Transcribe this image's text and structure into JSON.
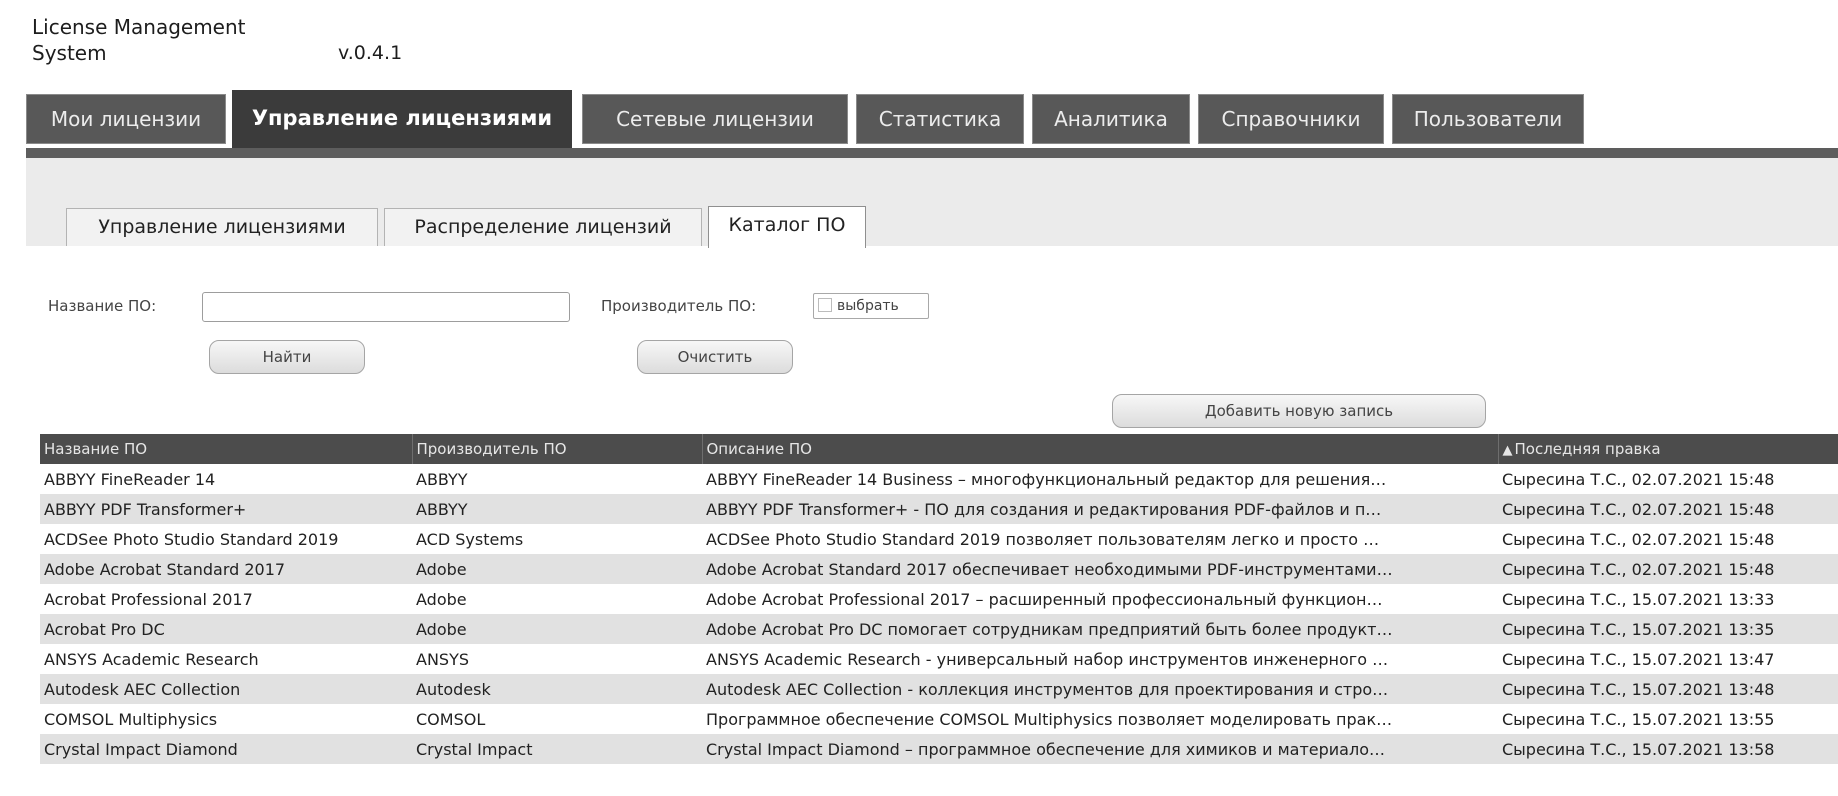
{
  "app": {
    "title": "License Management System",
    "version": "v.0.4.1"
  },
  "main_tabs": [
    {
      "label": "Мои лицензии",
      "active": false
    },
    {
      "label": "Управление лицензиями",
      "active": true
    },
    {
      "label": "Сетевые лицензии",
      "active": false
    },
    {
      "label": "Статистика",
      "active": false
    },
    {
      "label": "Аналитика",
      "active": false
    },
    {
      "label": "Справочники",
      "active": false
    },
    {
      "label": "Пользователи",
      "active": false
    }
  ],
  "sub_tabs": [
    {
      "label": "Управление лицензиями",
      "active": false
    },
    {
      "label": "Распределение лицензий",
      "active": false
    },
    {
      "label": "Каталог ПО",
      "active": true
    }
  ],
  "filter": {
    "name_label": "Название ПО:",
    "name_value": "",
    "vendor_label": "Производитель ПО:",
    "vendor_pick_label": "выбрать",
    "search_button": "Найти",
    "clear_button": "Очистить",
    "add_button": "Добавить новую запись"
  },
  "table": {
    "columns": [
      "Название ПО",
      "Производитель ПО",
      "Описание ПО",
      "Последняя правка"
    ],
    "sort_icon": "sort-ascending-icon",
    "rows": [
      {
        "name": "ABBYY FineReader 14",
        "vendor": "ABBYY",
        "description": "ABBYY FineReader 14 Business – многофункциональный редактор для решения…",
        "last_edit": "Сыресина Т.С., 02.07.2021 15:48"
      },
      {
        "name": "ABBYY PDF Transformer+",
        "vendor": "ABBYY",
        "description": "ABBYY PDF Transformer+ - ПО для создания и редактирования PDF-файлов и п…",
        "last_edit": "Сыресина Т.С., 02.07.2021 15:48"
      },
      {
        "name": "ACDSee Photo Studio Standard 2019",
        "vendor": "ACD Systems",
        "description": "ACDSee Photo Studio Standard 2019 позволяет пользователям легко и просто …",
        "last_edit": "Сыресина Т.С., 02.07.2021 15:48"
      },
      {
        "name": "Adobe Acrobat Standard 2017",
        "vendor": "Adobe",
        "description": "Adobe Acrobat Standard 2017 обеспечивает необходимыми PDF-инструментами…",
        "last_edit": "Сыресина Т.С., 02.07.2021 15:48"
      },
      {
        "name": "Acrobat Professional 2017",
        "vendor": "Adobe",
        "description": "Adobe Acrobat Professional 2017 – расширенный профессиональный функцион…",
        "last_edit": "Сыресина Т.С., 15.07.2021 13:33"
      },
      {
        "name": "Acrobat Pro DC",
        "vendor": "Adobe",
        "description": "Adobe Acrobat Pro DC помогает сотрудникам предприятий быть более продукт…",
        "last_edit": "Сыресина Т.С., 15.07.2021 13:35"
      },
      {
        "name": "ANSYS Academic Research",
        "vendor": "ANSYS",
        "description": "ANSYS Academic Research - универсальный набор инструментов инженерного …",
        "last_edit": "Сыресина Т.С., 15.07.2021 13:47"
      },
      {
        "name": "Autodesk AEC Collection",
        "vendor": "Autodesk",
        "description": "Autodesk AEC Collection - коллекция инструментов для проектирования и стро…",
        "last_edit": "Сыресина Т.С., 15.07.2021 13:48"
      },
      {
        "name": "COMSOL Multiphysics",
        "vendor": "COMSOL",
        "description": "Программное обеспечение COMSOL Multiphysics позволяет моделировать прак…",
        "last_edit": "Сыресина Т.С., 15.07.2021 13:55"
      },
      {
        "name": "Crystal Impact Diamond",
        "vendor": "Crystal Impact",
        "description": "Crystal Impact Diamond – программное обеспечение для химиков и материало…",
        "last_edit": "Сыресина Т.С., 15.07.2021 13:58"
      }
    ]
  }
}
